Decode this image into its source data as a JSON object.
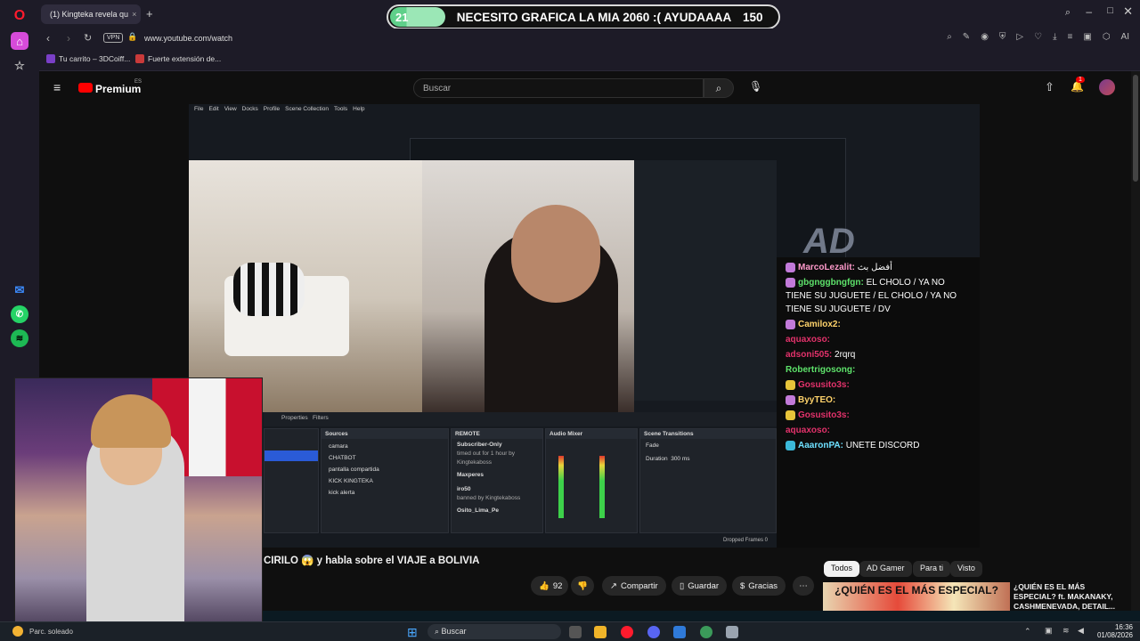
{
  "browser": {
    "tab_title": "(1) Kingteka revela qu",
    "url": "www.youtube.com/watch",
    "vpn_label": "VPN",
    "ai_label": "AI",
    "bookmarks": [
      "Tu carrito – 3DCoiff...",
      "Fuerte extensión de..."
    ]
  },
  "overlay_banner": {
    "count_left": "21",
    "message": "NECESITO GRAFICA LA MIA 2060 :( AYUDAAAA",
    "count_right": "150"
  },
  "youtube": {
    "brand": "Premium",
    "region": "ES",
    "search_placeholder": "Buscar",
    "notification_count": "1",
    "video_title": "CIRILO 😱 y habla sobre el VIAJE a BOLIVIA",
    "likes": "92",
    "share_label": "Compartir",
    "save_label": "Guardar",
    "thanks_label": "Gracias",
    "more_label": "⋯",
    "chips": [
      "Todos",
      "AD Gamer",
      "Para ti",
      "Visto"
    ],
    "rec_title": "¿QUIÉN ES EL MÁS ESPECIAL? ft. MAKANAKY, CASHMENEVADA, DETAIL...",
    "rec_thumb_text": "¿QUIÉN ES EL MÁS ESPECIAL?"
  },
  "obs": {
    "menu": [
      "File",
      "Edit",
      "View",
      "Docks",
      "Profile",
      "Scene Collection",
      "Tools",
      "Help"
    ],
    "tabs": [
      "Properties",
      "Filters"
    ],
    "sources_header": "Sources",
    "sources": [
      "camara",
      "CHATBOT",
      "pantalla compartida",
      "KICK KINGTEKA",
      "kick alerta"
    ],
    "remote_header": "REMOTE",
    "remote_items": [
      "Subscriber-Only",
      "Maxperes",
      "iro50",
      "Osito_Lima_Pe"
    ],
    "remote_notes": [
      "timed out for 1 hour by Kingtekaboss",
      "banned by Kingtekaboss"
    ],
    "mixer_header": "Audio Mixer",
    "transitions_header": "Scene Transitions",
    "transition_fade": "Fade",
    "duration_label": "Duration",
    "duration_value": "300 ms",
    "status": "Dropped Frames 0"
  },
  "stream_chat": [
    {
      "user": "MarcoLezalit:",
      "text": "أفضل بث",
      "color": "#ff9acb",
      "badge": "#c27ad9"
    },
    {
      "user": "gbgnggbngfgn:",
      "text": "EL CHOLO / YA NO TIENE SU JUGUETE / EL CHOLO / YA NO TIENE SU JUGUETE / DV",
      "color": "#5ee36b",
      "badge": "#c27ad9"
    },
    {
      "user": "Camilox2:",
      "text": "",
      "color": "#ffd36b",
      "badge": "#c27ad9"
    },
    {
      "user": "aquaxoso:",
      "text": "",
      "color": "#e3326b",
      "badge": ""
    },
    {
      "user": "adsoni505:",
      "text": "2rqrq",
      "color": "#e3326b",
      "badge": ""
    },
    {
      "user": "Robertrigosong:",
      "text": "",
      "color": "#5ee36b",
      "badge": ""
    },
    {
      "user": "Gosusito3s:",
      "text": "",
      "color": "#e3326b",
      "badge": "#e8c43a"
    },
    {
      "user": "ByyTEO:",
      "text": "",
      "color": "#ffd36b",
      "badge": "#c27ad9"
    },
    {
      "user": "Gosusito3s:",
      "text": "",
      "color": "#e3326b",
      "badge": "#e8c43a"
    },
    {
      "user": "aquaxoso:",
      "text": "",
      "color": "#e3326b",
      "badge": ""
    },
    {
      "user": "AaaronPA:",
      "text": "UNETE DISCORD",
      "color": "#6ee0ff",
      "badge": "#3bb9d9"
    }
  ],
  "taskbar": {
    "weather": "Parc. soleado",
    "search_label": "Buscar",
    "time": "16:36",
    "date": "01/08/2026"
  }
}
